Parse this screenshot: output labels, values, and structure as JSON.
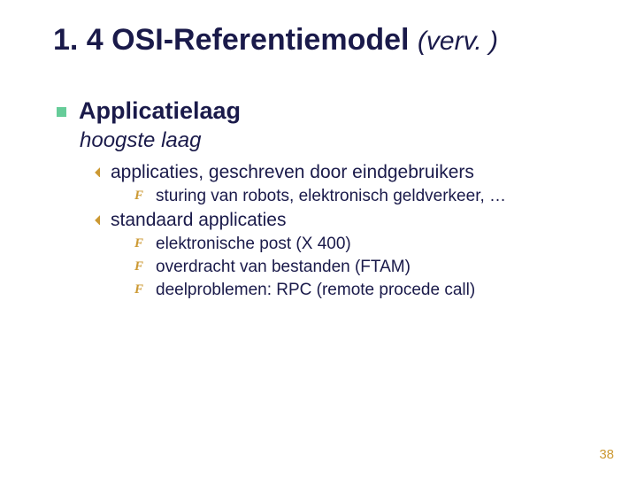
{
  "title": {
    "main": "1. 4 OSI-Referentiemodel ",
    "cont": "(verv. )"
  },
  "section": {
    "heading": "Applicatielaag",
    "subtitle": "hoogste laag"
  },
  "items": [
    {
      "label": "applicaties, geschreven door eindgebruikers",
      "children": [
        "sturing van robots, elektronisch geldverkeer, …"
      ]
    },
    {
      "label": "standaard applicaties",
      "children": [
        "elektronische post (X 400)",
        "overdracht van bestanden (FTAM)",
        "deelproblemen: RPC (remote procede call)"
      ]
    }
  ],
  "page_number": "38"
}
